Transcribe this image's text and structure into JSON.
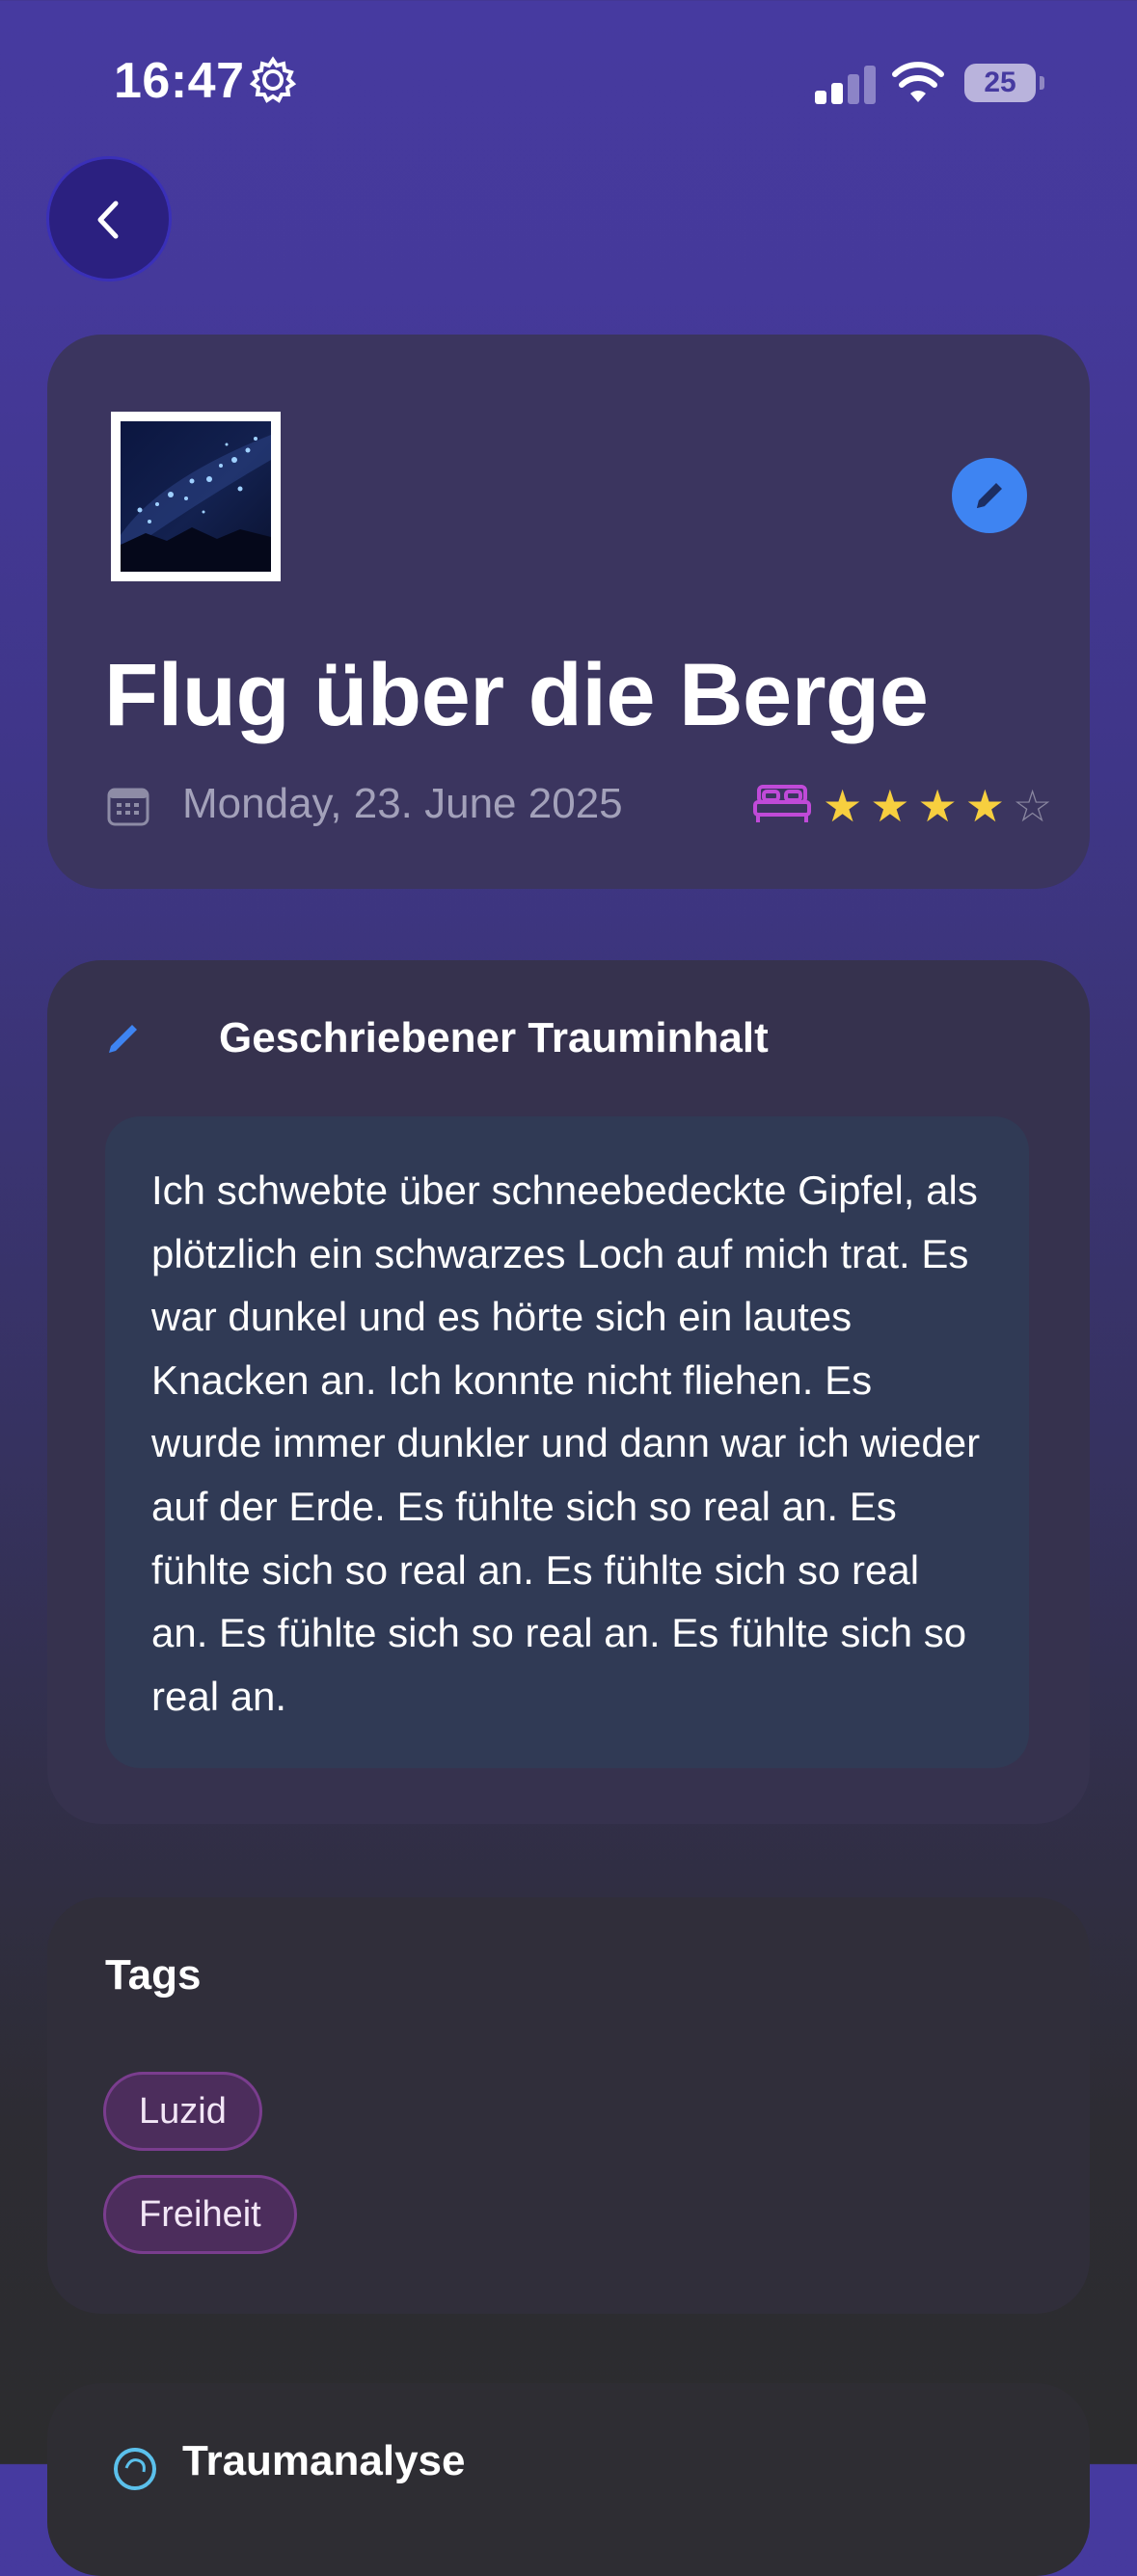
{
  "status_bar": {
    "time": "16:47",
    "battery": "25"
  },
  "header": {
    "title": "Flug über die Berge",
    "date": "Monday, 23. June 2025",
    "rating": 4,
    "rating_max": 5,
    "stars_full": "★★★★",
    "stars_empty": "☆"
  },
  "content": {
    "section_title": "Geschriebener Trauminhalt",
    "text": "Ich schwebte über schneebedeckte Gipfel, als plötzlich ein schwarzes Loch auf mich trat. Es war dunkel und es hörte sich ein lautes Knacken an. Ich konnte nicht fliehen. Es wurde immer dunkler und dann war ich wieder auf der Erde. Es fühlte sich so real an. Es fühlte sich so real an. Es fühlte sich so real an. Es fühlte sich so real an. Es fühlte sich so real an."
  },
  "tags": {
    "title": "Tags",
    "items": [
      "Luzid",
      "Freiheit"
    ]
  },
  "analysis": {
    "title": "Traumanalyse"
  },
  "colors": {
    "accent_blue": "#3e84f2",
    "star_yellow": "#f7cf3f",
    "bed_purple": "#c04ad8"
  }
}
